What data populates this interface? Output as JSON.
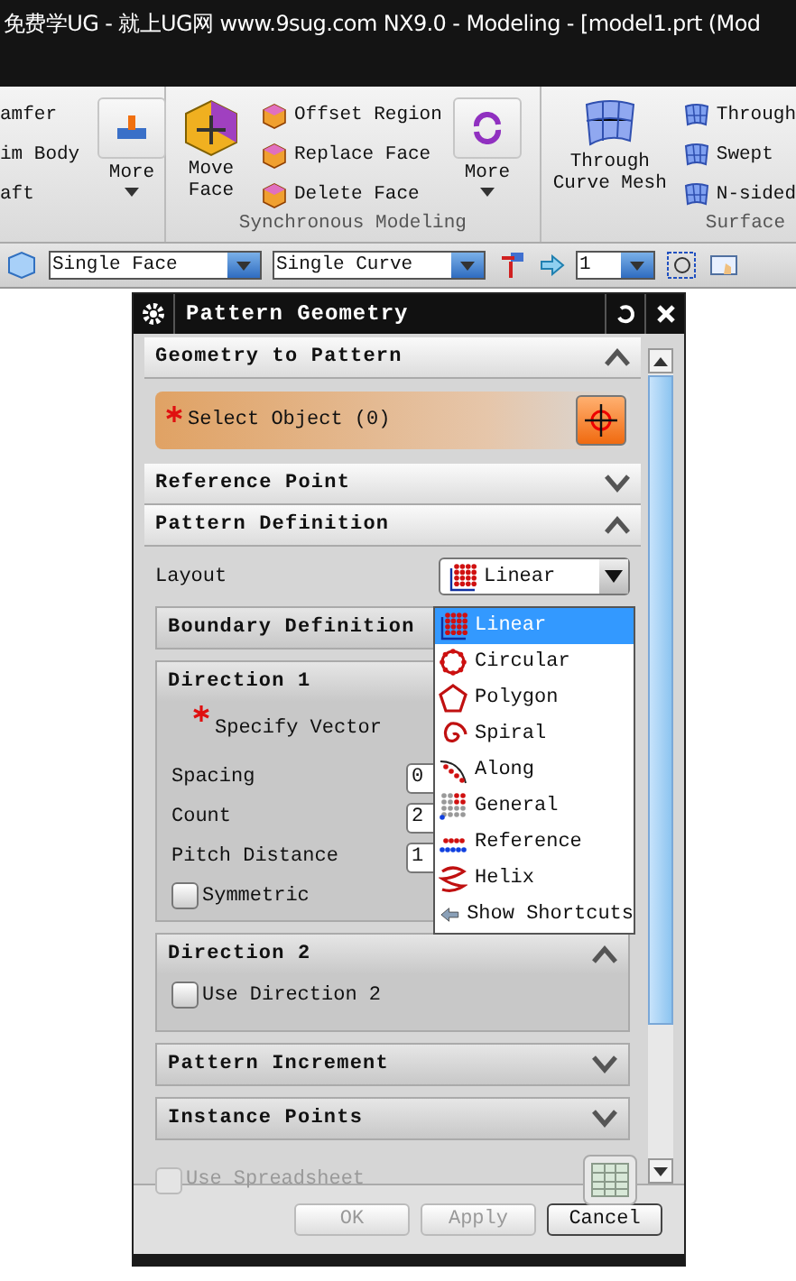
{
  "window": {
    "title": "免费学UG - 就上UG网 www.9sug.com NX9.0 - Modeling - [model1.prt (Mod"
  },
  "ribbon": {
    "cut_group": {
      "items": [
        "amfer",
        "im Body",
        "aft"
      ],
      "more": "More"
    },
    "sync_group": {
      "label": "Synchronous Modeling",
      "big_button": "Move Face",
      "items": [
        "Offset Region",
        "Replace Face",
        "Delete Face"
      ],
      "more": "More"
    },
    "surface_group": {
      "label": "Surface",
      "big_button": "Through Curve Mesh",
      "items": [
        "Through",
        "Swept",
        "N-sided"
      ]
    }
  },
  "toolbar": {
    "selects": [
      "Single Face",
      "Single Curve",
      "1"
    ]
  },
  "dialog": {
    "title": "Pattern Geometry",
    "sections": [
      {
        "kind": "selection",
        "title": "Geometry to Pattern",
        "expanded": true,
        "label": "Select Object (0)",
        "required": true
      },
      {
        "kind": "empty",
        "title": "Reference Point",
        "expanded": false
      },
      {
        "kind": "definition",
        "title": "Pattern Definition",
        "expanded": true,
        "layout": {
          "label": "Layout",
          "value": "Linear"
        },
        "subsections": [
          {
            "kind": "plain",
            "title": "Boundary Definition"
          },
          {
            "kind": "direction",
            "title": "Direction 1",
            "vector": {
              "label": "Specify Vector",
              "required": true
            },
            "fields": [
              {
                "label": "Spacing",
                "value": "0"
              },
              {
                "label": "Count",
                "value": "2"
              },
              {
                "label": "Pitch Distance",
                "value": "1"
              }
            ],
            "checkbox": {
              "label": "Symmetric",
              "checked": false
            }
          },
          {
            "kind": "toggle",
            "title": "Direction 2",
            "expanded": true,
            "checkbox": {
              "label": "Use Direction 2",
              "checked": false
            }
          },
          {
            "kind": "plain",
            "title": "Pattern Increment",
            "expanded": false
          },
          {
            "kind": "plain",
            "title": "Instance Points",
            "expanded": false
          }
        ]
      }
    ],
    "spreadsheet": {
      "label": "Use Spreadsheet",
      "checked": false,
      "disabled": true
    },
    "buttons": [
      {
        "label": "OK",
        "disabled": true
      },
      {
        "label": "Apply",
        "disabled": true
      },
      {
        "label": "Cancel",
        "disabled": false
      }
    ],
    "dropdown": {
      "options": [
        {
          "label": "Linear",
          "selected": true
        },
        {
          "label": "Circular",
          "selected": false
        },
        {
          "label": "Polygon",
          "selected": false
        },
        {
          "label": "Spiral",
          "selected": false
        },
        {
          "label": "Along",
          "selected": false
        },
        {
          "label": "General",
          "selected": false
        },
        {
          "label": "Reference",
          "selected": false
        },
        {
          "label": "Helix",
          "selected": false
        },
        {
          "label": "Show Shortcuts",
          "selected": false
        }
      ]
    }
  }
}
